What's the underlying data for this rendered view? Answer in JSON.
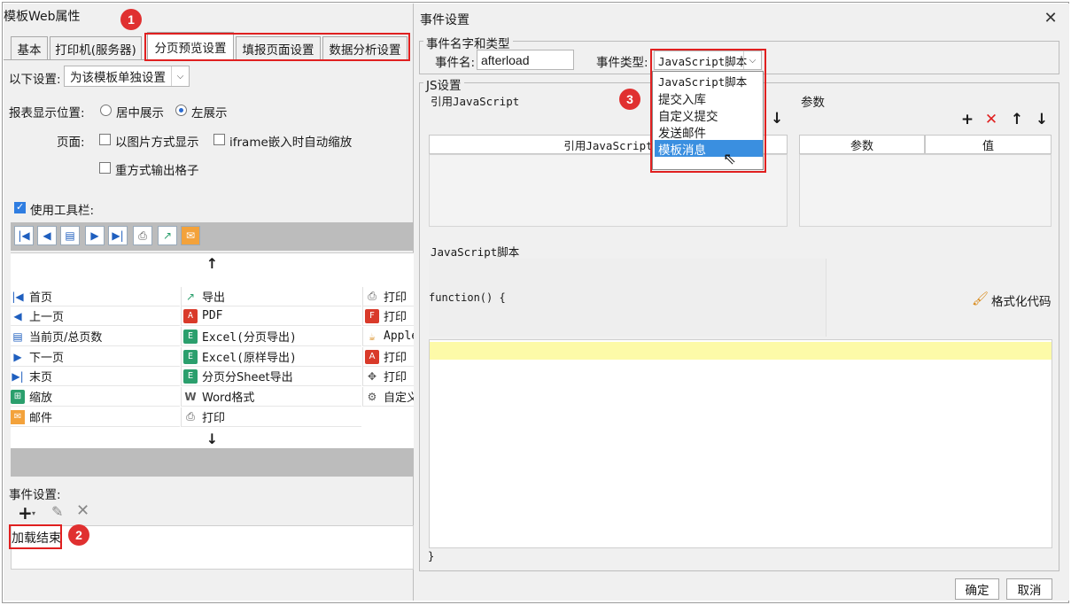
{
  "left_window": {
    "title": "模板Web属性",
    "tabs": [
      {
        "label": "基本"
      },
      {
        "label": "打印机(服务器)"
      },
      {
        "label": "分页预览设置"
      },
      {
        "label": "填报页面设置"
      },
      {
        "label": "数据分析设置"
      }
    ],
    "active_tab": "分页预览设置",
    "settings_scope_label": "以下设置:",
    "settings_scope_value": "为该模板单独设置",
    "report_position_label": "报表显示位置:",
    "position_center": "居中展示",
    "position_left": "左展示",
    "position_selected": "左展示",
    "page_label": "页面:",
    "option_image_mode": "以图片方式显示",
    "option_iframe_autoscale": "iframe嵌入时自动缩放",
    "option_reformat_cells": "重方式输出格子",
    "use_toolbar_label": "使用工具栏:",
    "use_toolbar_checked": true,
    "button_list": {
      "col1": [
        "首页",
        "上一页",
        "当前页/总页数",
        "下一页",
        "末页",
        "缩放",
        "邮件"
      ],
      "col2": [
        "导出",
        "PDF",
        "Excel(分页导出)",
        "Excel(原样导出)",
        "分页分Sheet导出",
        "Word格式",
        "打印"
      ],
      "col3": [
        "打印",
        "打印",
        "Apple",
        "打印",
        "打印",
        "自定义"
      ]
    },
    "event_settings_label": "事件设置:",
    "event_item": "加载结束"
  },
  "event_dialog": {
    "title": "事件设置",
    "name_type_group": "事件名字和类型",
    "event_name_label": "事件名:",
    "event_name_value": "afterload",
    "event_type_label": "事件类型:",
    "event_type_value": "JavaScript脚本",
    "event_type_options": [
      "JavaScript脚本",
      "提交入库",
      "自定义提交",
      "发送邮件",
      "模板消息"
    ],
    "event_type_highlighted": "模板消息",
    "js_group": "JS设置",
    "ref_js_label": "引用JavaScript",
    "ref_js_column": "引用JavaScript",
    "params_label": "参数",
    "params_col_name": "参数",
    "params_col_value": "值",
    "js_script_label": "JavaScript脚本",
    "function_header": "function() {",
    "function_footer": "}",
    "format_code_label": "格式化代码",
    "ok_label": "确定",
    "cancel_label": "取消"
  },
  "callouts": [
    "1",
    "2",
    "3"
  ],
  "colors": {
    "highlight_red": "#e02020",
    "selection_blue": "#3a8fe0",
    "editor_line_yellow": "#fdfaa8",
    "toolbar_gray": "#bcbcbc"
  }
}
